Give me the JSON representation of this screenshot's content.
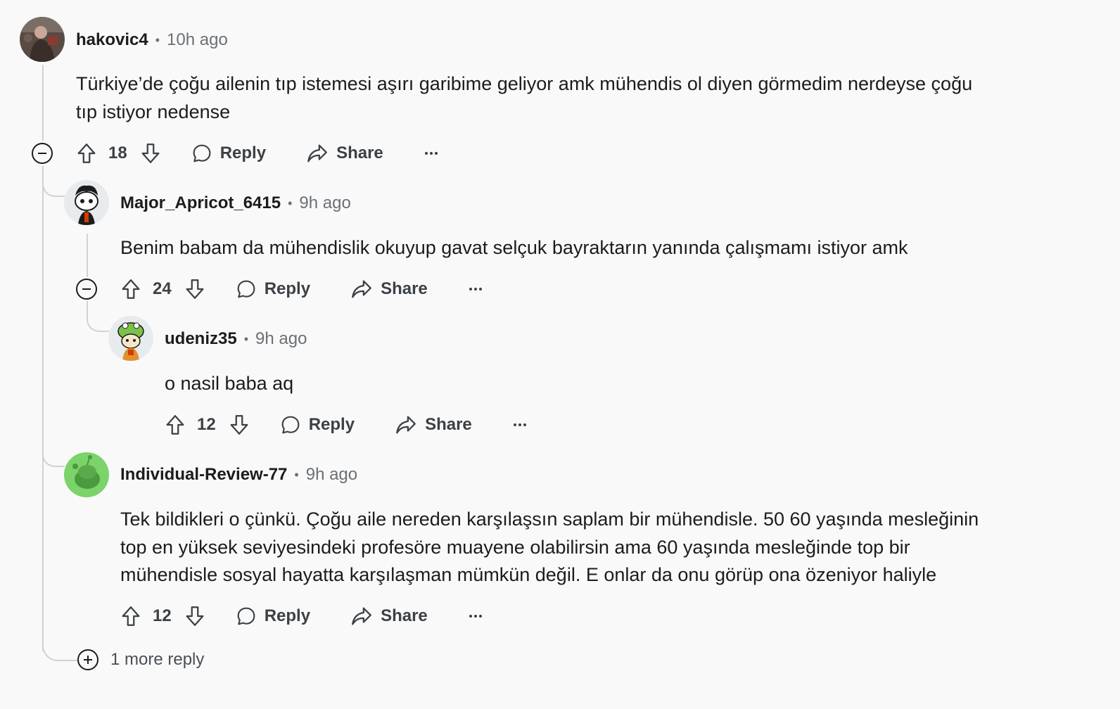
{
  "comments": [
    {
      "author": "hakovic4",
      "time": "10h ago",
      "text_line1": "Türkiye’de çoğu ailenin tıp istemesi aşırı garibime geliyor amk mühendis ol diyen görmedim nerdeyse çoğu",
      "text_line2": "tıp istiyor nedense",
      "votes": "18",
      "reply_label": "Reply",
      "share_label": "Share"
    },
    {
      "author": "Major_Apricot_6415",
      "time": "9h ago",
      "text_line1": "Benim babam da mühendislik okuyup gavat selçuk bayraktarın yanında çalışmamı istiyor amk",
      "votes": "24",
      "reply_label": "Reply",
      "share_label": "Share"
    },
    {
      "author": "udeniz35",
      "time": "9h ago",
      "text_line1": "o nasil baba aq",
      "votes": "12",
      "reply_label": "Reply",
      "share_label": "Share"
    },
    {
      "author": "Individual-Review-77",
      "time": "9h ago",
      "text_line1": "Tek bildikleri o çünkü. Çoğu aile nereden karşılaşsın saplam bir mühendisle. 50 60 yaşında mesleğinin",
      "text_line2": "top en yüksek seviyesindeki profesöre muayene olabilirsin ama 60 yaşında mesleğinde top bir",
      "text_line3": "mühendisle sosyal hayatta karşılaşman mümkün değil. E onlar da onu görüp ona özeniyor haliyle",
      "votes": "12",
      "reply_label": "Reply",
      "share_label": "Share"
    }
  ],
  "more_replies_label": "1 more reply",
  "colors": {
    "background": "#f9f9f9",
    "thread_line": "#cfd3d6",
    "text": "#1c1c1c",
    "muted": "#6b7075"
  }
}
